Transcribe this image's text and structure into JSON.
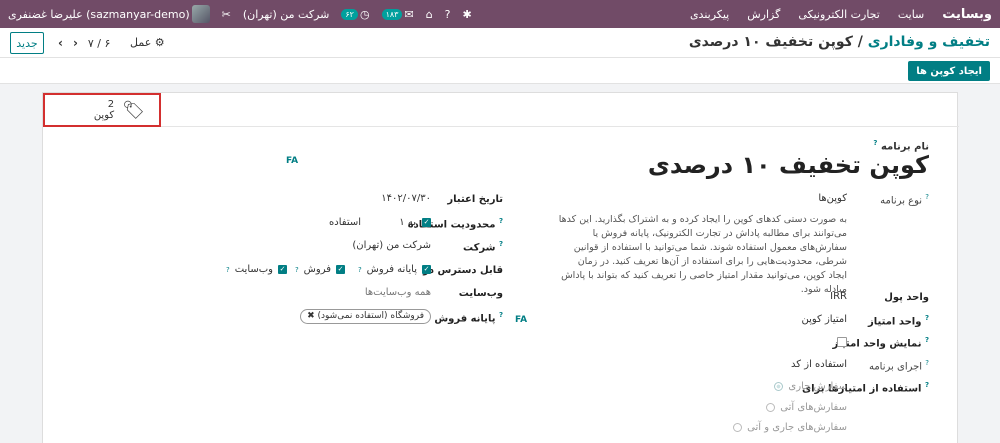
{
  "navbar": {
    "brand": "وبسایت",
    "menu": [
      "سایت",
      "تجارت الکترونیکی",
      "گزارش",
      "پیکربندی"
    ],
    "company": "شرکت من (تهران)",
    "user": "علیرضا غضنفری (sazmanyar-demo)",
    "activity_count": "۶۲",
    "message_count": "۱۸۳"
  },
  "control": {
    "breadcrumb_parent": "تخفیف و وفاداری",
    "breadcrumb_sep": "/",
    "breadcrumb_current": "کوپن تخفیف ۱۰ درصدی",
    "new_label": "جدید",
    "pager": "۷ / ۶",
    "action_label": "عمل"
  },
  "buttonbar": {
    "generate_label": "ایجاد کوپن ها"
  },
  "stat": {
    "count": "2",
    "label": "کوپن"
  },
  "form": {
    "program_name_label": "نام برنامه",
    "title": "کوپن تخفیف ۱۰ درصدی",
    "fa": "FA",
    "program_type_label": "نوع برنامه",
    "program_type_value": "کوپن‌ها",
    "program_type_desc": "به صورت دستی کدهای کوپن را ایجاد کرده و به اشتراک بگذارید. این کدها می‌توانند برای مطالبه پاداش در تجارت الکترونیک، پایانه فروش یا سفارش‌های معمول استفاده شوند. شما می‌توانید با استفاده از قوانین شرطی، محدودیت‌هایی را برای استفاده از آن‌ها تعریف کنید. در زمان ایجاد کوپن، می‌توانید مقدار امتیاز خاصی را تعریف کنید که بتواند با پاداش مبادله شود.",
    "currency_label": "واحد پول",
    "currency_value": "IRR",
    "points_unit_label": "واحد امتیاز",
    "points_unit_value": "امتیاز کوپن",
    "show_points_label": "نمایش واحد امتیاز",
    "apply_label": "اجرای برنامه",
    "apply_value": "استفاده از کد",
    "use_points_label": "استفاده از امتیازها برای",
    "use_points_options": [
      "سفارش جاری",
      "سفارش‌های آتی",
      "سفارش‌های جاری و آتی"
    ],
    "validity_label": "تاریخ اعتبار",
    "validity_value": "۱۴۰۲/۰۷/۳۰",
    "limit_label": "محدودیت استفاده",
    "limit_value": "به ۱",
    "limit_unit": "استفاده",
    "company_label": "شرکت",
    "company_value": "شرکت من (تهران)",
    "available_label": "قابل دسترس در",
    "available_options": [
      "پایانه فروش",
      "فروش",
      "وب‌سایت"
    ],
    "website_label": "وب‌سایت",
    "website_value": "همه وب‌سایت‌ها",
    "pos_label": "پایانه فروش",
    "pos_chip": "فروشگاه (استفاده نمی‌شود)"
  }
}
